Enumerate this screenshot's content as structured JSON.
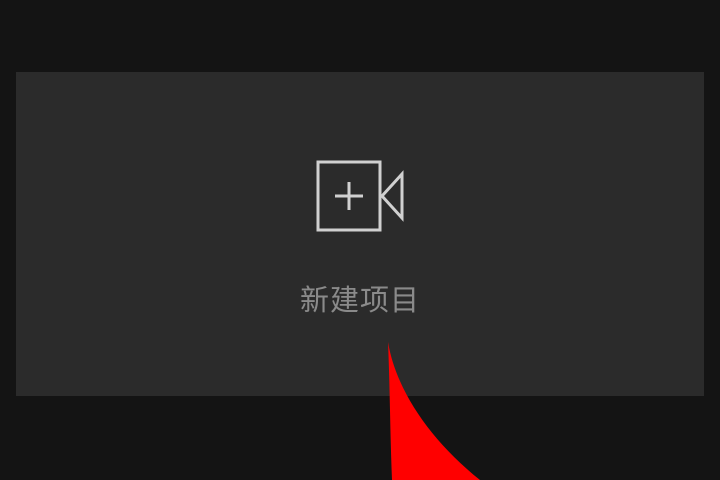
{
  "new_project": {
    "label": "新建项目",
    "icon": "video-camera-plus-icon"
  },
  "annotation": {
    "arrow_color": "#ff0000",
    "icon": "red-arrow-annotation"
  },
  "colors": {
    "background": "#141414",
    "card": "#2b2b2b",
    "icon_stroke": "#d0d0d0",
    "label": "#8a8a8a"
  }
}
